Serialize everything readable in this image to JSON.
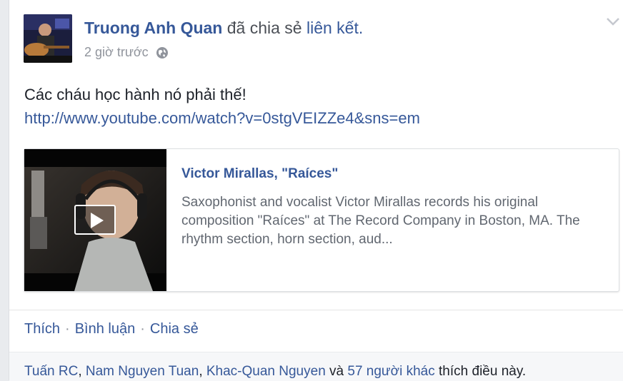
{
  "post": {
    "author": "Truong Anh Quan",
    "action_text": "đã chia sẻ",
    "action_link": "liên kết.",
    "time": "2 giờ trước",
    "status": "Các cháu học hành nó phải thế!",
    "url": "http://www.youtube.com/watch?v=0stgVEIZZe4&sns=em"
  },
  "attachment": {
    "title": "Victor Mirallas, \"Raíces\"",
    "description": "Saxophonist and vocalist Victor Mirallas records his original composition \"Raíces\" at The Record Company in Boston, MA. The rhythm section, horn section, aud..."
  },
  "actions": {
    "like": "Thích",
    "sep1": "·",
    "comment": "Bình luận",
    "sep2": "·",
    "share": "Chia sẻ"
  },
  "likes": {
    "name1": "Tuấn RC",
    "comma1": ", ",
    "name2": "Nam Nguyen Tuan",
    "comma2": ", ",
    "name3": "Khac-Quan Nguyen",
    "and": " và ",
    "others": "57 người khác",
    "suffix": " thích điều này."
  },
  "icons": {
    "menu": "chevron-down-icon",
    "privacy": "globe-icon",
    "play": "play-icon"
  },
  "colors": {
    "link": "#365899",
    "secondary_text": "#90949c",
    "text": "#1d2129"
  }
}
